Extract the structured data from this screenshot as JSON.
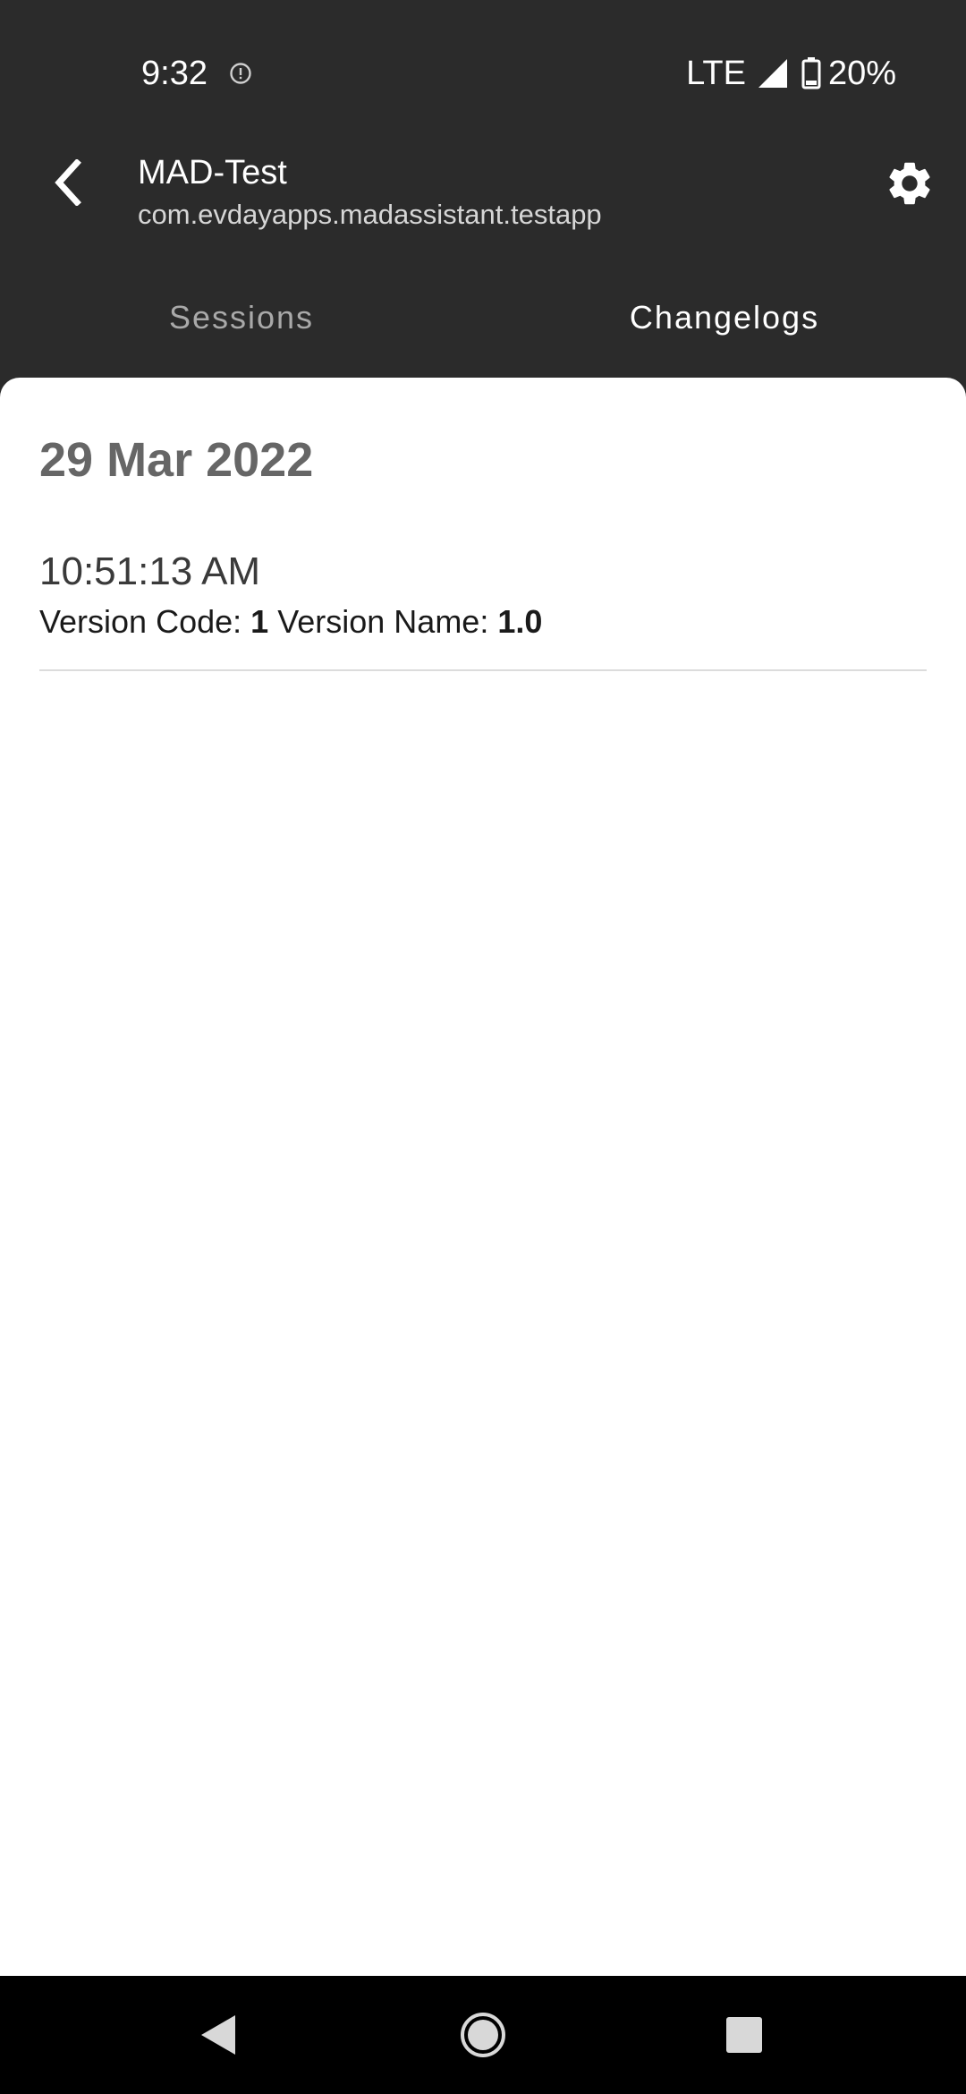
{
  "status_bar": {
    "time": "9:32",
    "network": "LTE",
    "battery": "20%"
  },
  "app_bar": {
    "title": "MAD-Test",
    "subtitle": "com.evdayapps.madassistant.testapp"
  },
  "tabs": [
    {
      "label": "Sessions",
      "active": false
    },
    {
      "label": "Changelogs",
      "active": true
    }
  ],
  "changelog": {
    "date": "29 Mar 2022",
    "entries": [
      {
        "time": "10:51:13 AM",
        "version_code_label": "Version Code:",
        "version_code": "1",
        "version_name_label": "Version Name:",
        "version_name": "1.0"
      }
    ]
  },
  "colors": {
    "header_bg": "#2b2b2b",
    "content_bg": "#ffffff",
    "nav_bg": "#000000"
  }
}
